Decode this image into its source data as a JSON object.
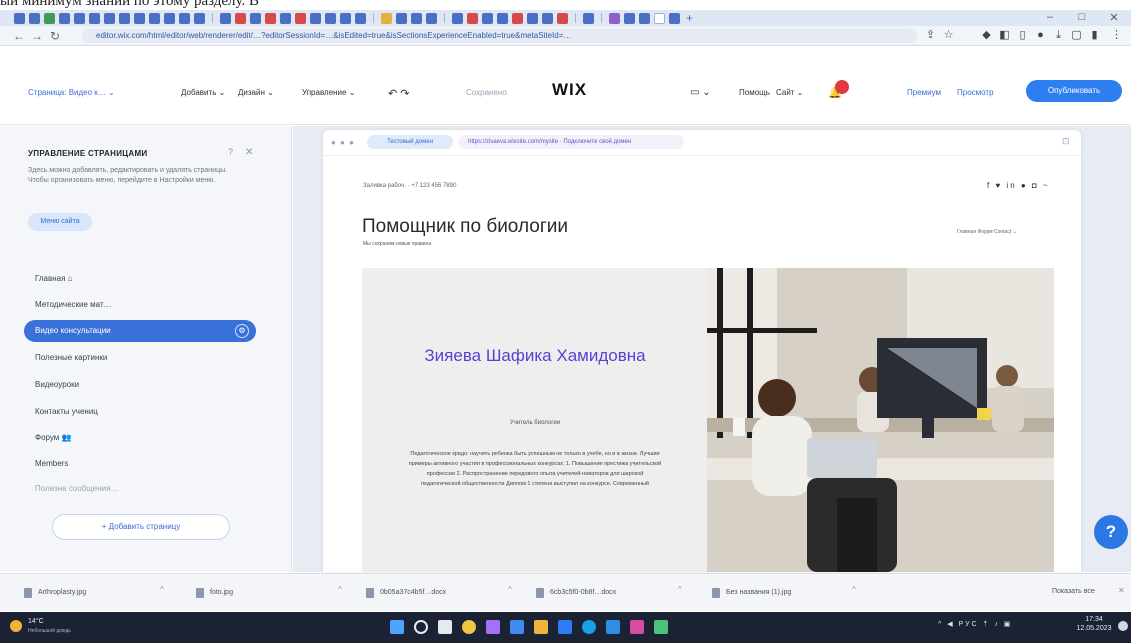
{
  "top_line_text": "ый минимум знаний по этому разделу. В",
  "browser": {
    "url": "editor.wix.com/html/editor/web/renderer/edit/…?editorSessionId=…&isEdited=true&isSectionsExperienceEnabled=true&metaSiteId=…",
    "window_controls": {
      "minimize": "–",
      "maximize": "□",
      "close": "✕"
    }
  },
  "wix": {
    "menu": {
      "site": "Страница: Видео к…",
      "add": "Добавить",
      "design": "Дизайн",
      "manage": "Управление",
      "save": "Сохранено",
      "logo": "WIX",
      "help": "Помощь",
      "site2": "Сайт",
      "upgrade": "Премиум",
      "preview": "Просмотр",
      "publish": "Опубликовать"
    }
  },
  "pages_panel": {
    "title": "УПРАВЛЕНИЕ СТРАНИЦАМИ",
    "help": "?",
    "close": "✕",
    "description": "Здесь можно добавлять, редактировать и удалять страницы. Чтобы организовать меню, перейдите в Настройки меню.",
    "button": "Меню сайта",
    "items": [
      "Главная ⌂",
      "Методические мат…",
      "Видео консультации",
      "Полезные картинки",
      "Видеоуроки",
      "Контакты учениц",
      "Форум 👥",
      "Members",
      "Полезна сообщения…"
    ],
    "selected_index": 2,
    "selected_gear": "⚙",
    "add_page": "+ Добавить страницу"
  },
  "site": {
    "chip_label": "Тестовый домен",
    "chip_url": "https://zivaeva.wixsite.com/mysite · Подключите свой домен",
    "phone": "Заливка рабоч. · +7 123 456 7890",
    "social": "f ♥ in ● ◘ ~",
    "title": "Помощник по биологии",
    "subtitle": "Мы сохраним новые правила",
    "nav": "Главная   Форум   Contact ⌄",
    "hero_name": "Зияева Шафика Хамидовна",
    "hero_role": "Учитель биологии",
    "hero_text": "Педагогическое кредо: научить ребенка быть успешным не только в учебе, но и в жизни. Лучшие примеры активного участия в профессиональных конкурсах: 1. Повышение престижа учительской профессии 2. Распространение передового опыта учителей-новаторов для широкой педагогической общественности Диплом 1 степени выступил на конкурсе. Современный"
  },
  "help_button": "?",
  "downloads": {
    "items": [
      "Arthroplasty.jpg",
      "foto.jpg",
      "0b05a37c4b5f…docx",
      "6cb3c5f0-0b8f…docx",
      "Без названия (1).jpg"
    ],
    "show_all": "Показать все",
    "close": "✕"
  },
  "taskbar": {
    "temperature": "14°C",
    "weather": "Небольшой дождь",
    "tray": "^ ◀ РУС ⇡ ♪ ▣",
    "time": "17:34",
    "date": "12.05.2023"
  }
}
